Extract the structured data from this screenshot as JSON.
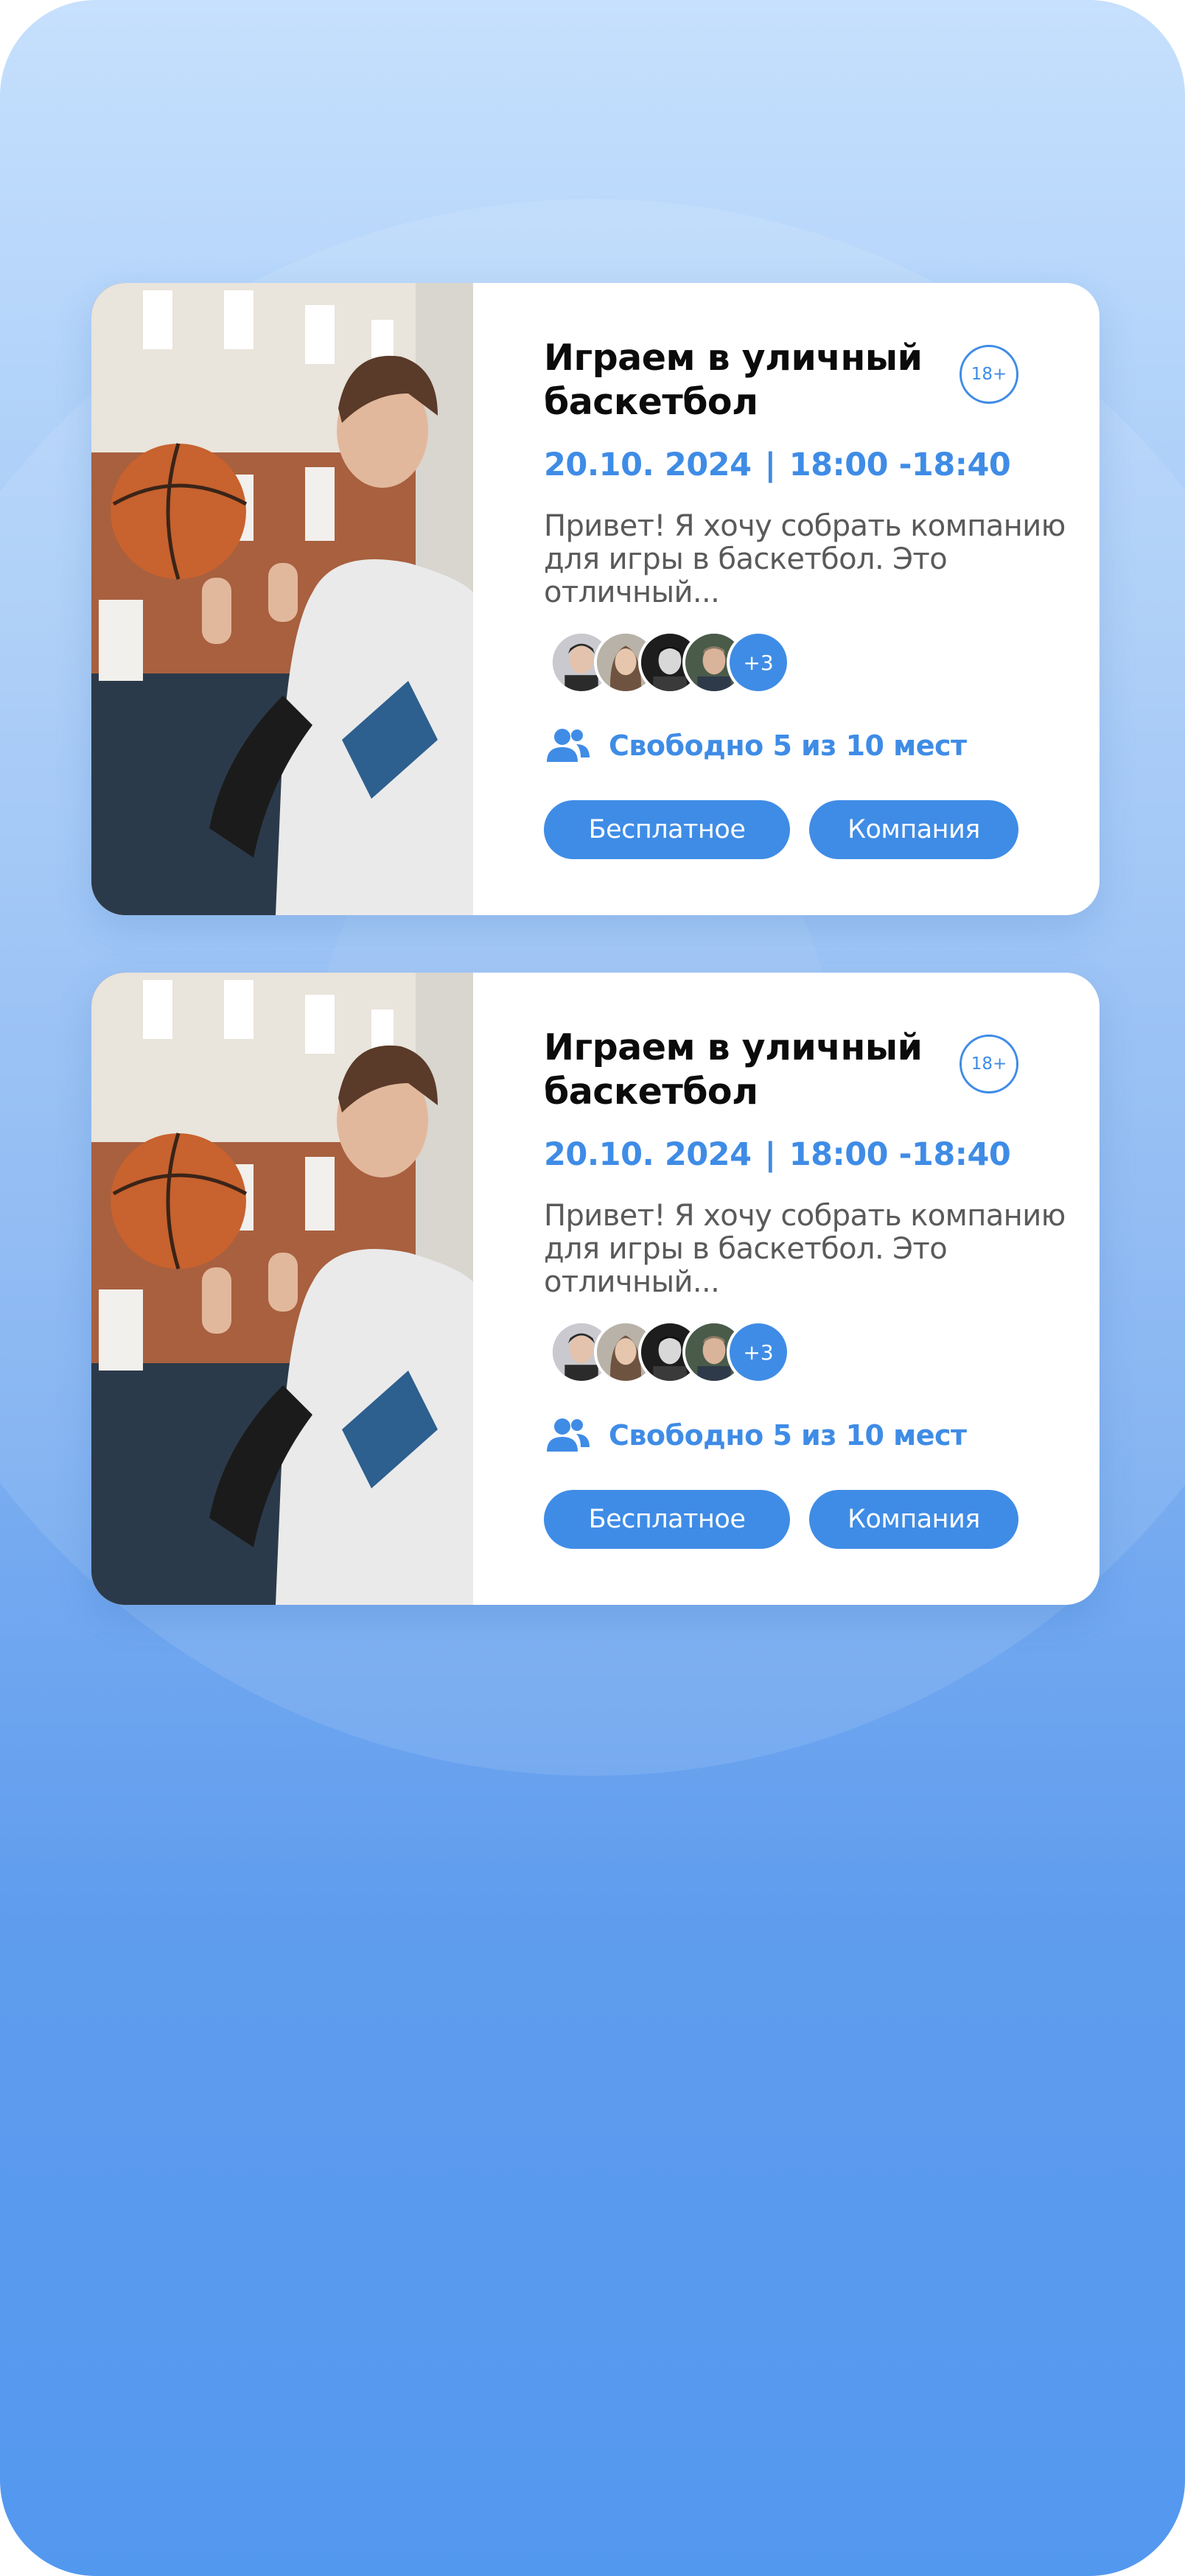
{
  "colors": {
    "accent": "#3f8ce6",
    "title": "#0b0b0b",
    "text": "#5a5a5a",
    "background_top": "#c6e0fd",
    "background_bottom": "#5398ef"
  },
  "events": [
    {
      "title": "Играем в уличный баскетбол",
      "age_rating": "18+",
      "date": "20.10. 2024",
      "separator": "|",
      "time": "18:00 -18:40",
      "description": "Привет! Я хочу собрать компанию для игры в баскетбол. Это отличный...",
      "participants_more": "+3",
      "seats_icon": "users-icon",
      "seats_text": "Свободно 5 из 10 мест",
      "tags": [
        "Бесплатное",
        "Компания"
      ]
    },
    {
      "title": "Играем в уличный баскетбол",
      "age_rating": "18+",
      "date": "20.10. 2024",
      "separator": "|",
      "time": "18:00 -18:40",
      "description": "Привет! Я хочу собрать компанию для игры в баскетбол. Это отличный...",
      "participants_more": "+3",
      "seats_icon": "users-icon",
      "seats_text": "Свободно 5 из 10 мест",
      "tags": [
        "Бесплатное",
        "Компания"
      ]
    }
  ]
}
